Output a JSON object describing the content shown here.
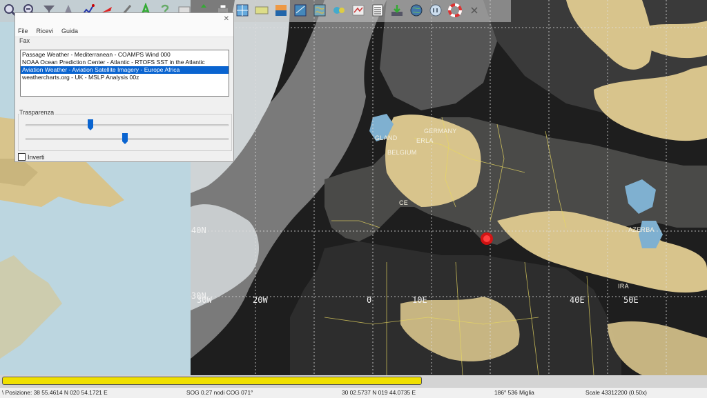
{
  "toolbar": {
    "buttons": [
      {
        "name": "zoom-in-icon"
      },
      {
        "name": "zoom-out-icon"
      },
      {
        "name": "funnel-icon"
      },
      {
        "name": "ship-icon"
      },
      {
        "name": "route-icon"
      },
      {
        "name": "boat-icon"
      },
      {
        "name": "pen-icon"
      },
      {
        "name": "text-a-icon"
      },
      {
        "name": "help-icon"
      },
      {
        "name": "panel-icon"
      },
      {
        "name": "arrows-icon"
      },
      {
        "name": "print-icon"
      },
      {
        "name": "chart-grid-icon"
      },
      {
        "name": "chart-layer-icon"
      },
      {
        "name": "waves-icon"
      },
      {
        "name": "grib-icon"
      },
      {
        "name": "grib-wind-icon"
      },
      {
        "name": "tides-icon"
      },
      {
        "name": "weather-fax-icon"
      },
      {
        "name": "list-icon"
      },
      {
        "name": "download-icon"
      },
      {
        "name": "globe-icon"
      },
      {
        "name": "scale-icon"
      },
      {
        "name": "lifebuoy-icon"
      },
      {
        "name": "close-icon"
      }
    ]
  },
  "fax_dialog": {
    "menu": [
      "File",
      "Ricevi",
      "Guida"
    ],
    "group_label": "Fax",
    "items": [
      "Passage Weather - Mediterranean - COAMPS Wind 000",
      "NOAA Ocean Prediction Center - Atlantic - RTOFS SST in the Atlantic",
      "Aviation Weather - Aviation Satellite Imagery - Europe Africa",
      "weathercharts.org - UK - MSLP Analysis 00z"
    ],
    "selected_index": 2,
    "transparency_label": "Trasparenza",
    "slider1_value": 0.32,
    "slider2_value": 0.49,
    "invert_label": "Inverti",
    "invert_checked": false
  },
  "map": {
    "lat_labels": [
      "40N",
      "30N"
    ],
    "lon_labels": [
      "30W",
      "20W",
      "0",
      "10E",
      "40E",
      "50E"
    ],
    "country_labels": [
      "GERMANY",
      "GLAND",
      "ERLA",
      "BELGIUM",
      "CE",
      "AZERBA",
      "IRA"
    ]
  },
  "progress": {
    "value": 0.6
  },
  "status": {
    "position": "\\ Posizione: 38 55.4614 N   020 54.1721 E",
    "sog_cog": "SOG 0.27 nodi   COG 071°",
    "cursor": "30 02.5737 N   019 44.0735 E",
    "bearing": "186°   536 Miglia",
    "scale": "Scale 43312200 (0.50x)"
  },
  "colors": {
    "land": "#d8c48c",
    "cloud": "#e8e8e8",
    "sea": "#bcd6e0",
    "selection": "#0a64d0",
    "progress": "#f0e000"
  }
}
